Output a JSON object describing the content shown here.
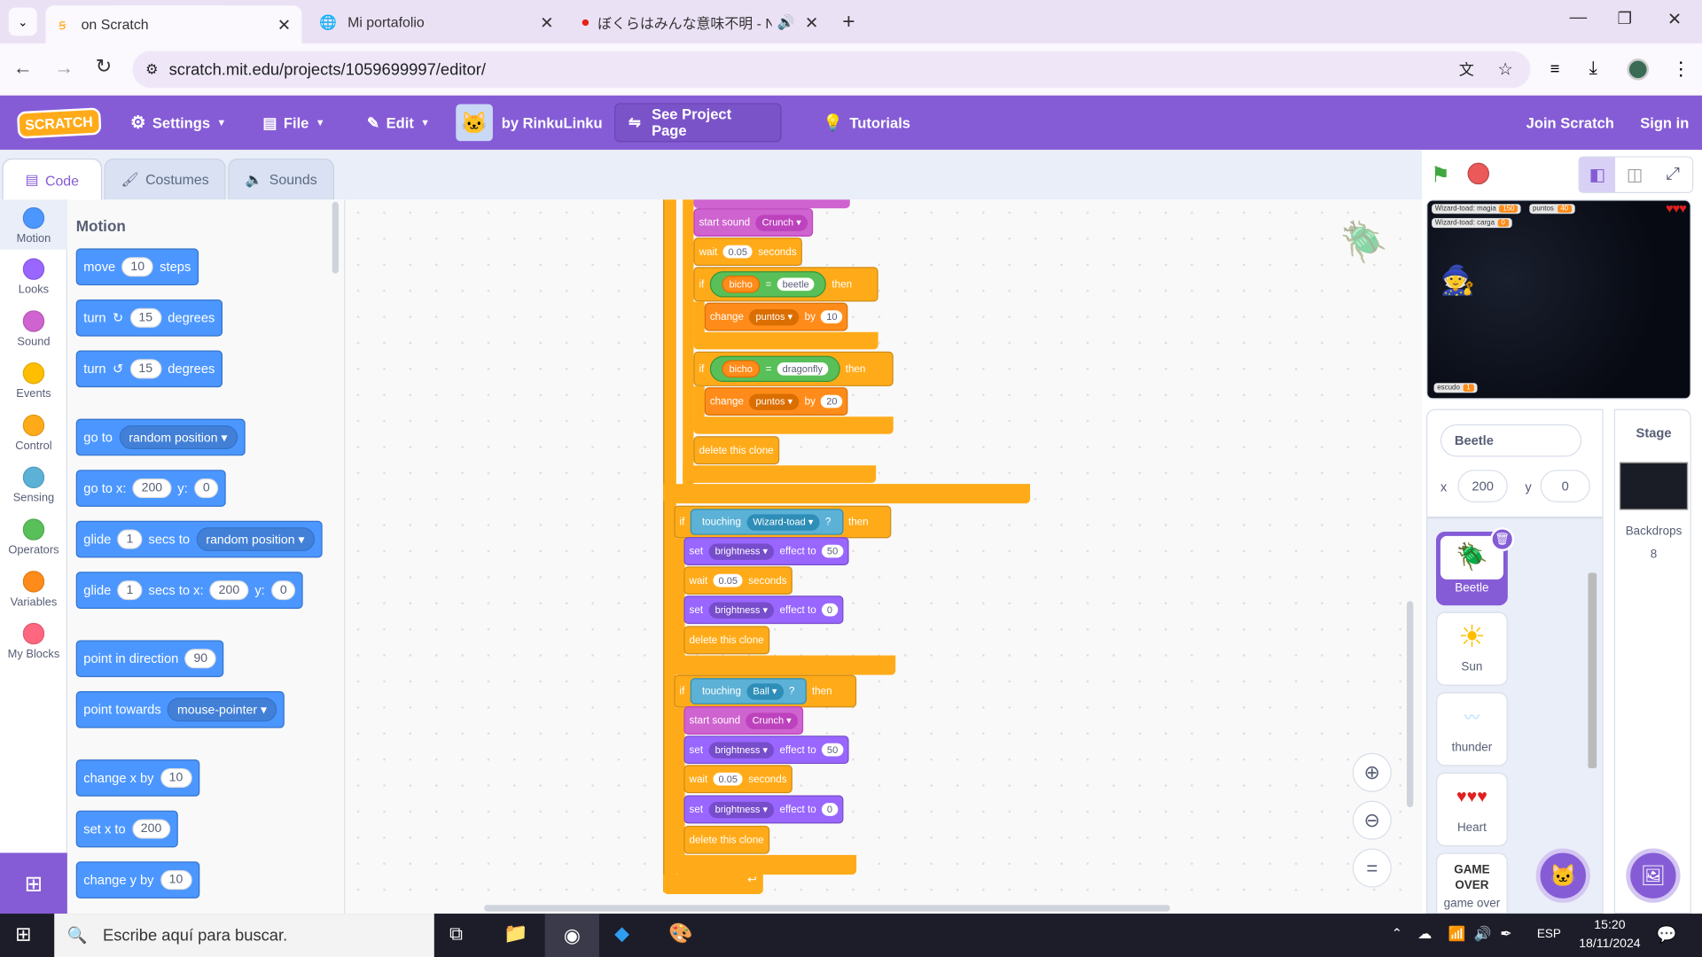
{
  "browser": {
    "tabs": [
      {
        "title": "on Scratch",
        "active": true
      },
      {
        "title": "Mi portafolio",
        "active": false
      },
      {
        "title": "ぼくらはみんな意味不明 - Nol",
        "active": false
      }
    ],
    "url": "scratch.mit.edu/projects/1059699997/editor/"
  },
  "menu": {
    "logo": "SCRATCH",
    "settings": "Settings",
    "file": "File",
    "edit": "Edit",
    "by": "by RinkuLinku",
    "see_project": "See Project Page",
    "tutorials": "Tutorials",
    "join": "Join Scratch",
    "signin": "Sign in"
  },
  "editor_tabs": {
    "code": "Code",
    "costumes": "Costumes",
    "sounds": "Sounds"
  },
  "categories": [
    {
      "label": "Motion",
      "color": "#4c97ff"
    },
    {
      "label": "Looks",
      "color": "#9966ff"
    },
    {
      "label": "Sound",
      "color": "#cf63cf"
    },
    {
      "label": "Events",
      "color": "#ffbf00"
    },
    {
      "label": "Control",
      "color": "#ffab19"
    },
    {
      "label": "Sensing",
      "color": "#5cb1d6"
    },
    {
      "label": "Operators",
      "color": "#59c059"
    },
    {
      "label": "Variables",
      "color": "#ff8c1a"
    },
    {
      "label": "My Blocks",
      "color": "#ff6680"
    }
  ],
  "palette": {
    "heading": "Motion",
    "move": {
      "a": "move",
      "n": "10",
      "b": "steps"
    },
    "turn_cw": {
      "a": "turn",
      "n": "15",
      "b": "degrees"
    },
    "turn_ccw": {
      "a": "turn",
      "n": "15",
      "b": "degrees"
    },
    "goto": {
      "a": "go to",
      "d": "random position"
    },
    "gotoxy": {
      "a": "go to x:",
      "x": "200",
      "b": "y:",
      "y": "0"
    },
    "glide1": {
      "a": "glide",
      "n": "1",
      "b": "secs to",
      "d": "random position"
    },
    "glide2": {
      "a": "glide",
      "n": "1",
      "b": "secs to x:",
      "x": "200",
      "c": "y:",
      "y": "0"
    },
    "point_dir": {
      "a": "point in direction",
      "n": "90"
    },
    "point_towards": {
      "a": "point towards",
      "d": "mouse-pointer"
    },
    "change_x": {
      "a": "change x by",
      "n": "10"
    },
    "set_x": {
      "a": "set x to",
      "n": "200"
    },
    "change_y": {
      "a": "change y by",
      "n": "10"
    }
  },
  "script": {
    "start_sound": "start sound",
    "crunch": "Crunch",
    "wait": "wait",
    "seconds": "seconds",
    "w005": "0.05",
    "if": "if",
    "then": "then",
    "bicho": "bicho",
    "eq": "=",
    "beetle": "beetle",
    "dragonfly": "dragonfly",
    "change": "change",
    "puntos": "puntos",
    "by": "by",
    "n10": "10",
    "n20": "20",
    "delete_clone": "delete this clone",
    "touching": "touching",
    "wizard": "Wizard-toad",
    "ball": "Ball",
    "q": "?",
    "set": "set",
    "brightness": "brightness",
    "effect_to": "effect to",
    "n50": "50",
    "n0": "0"
  },
  "stage": {
    "mon1": "Wizard-toad: magia",
    "mon1v": "150",
    "mon2": "puntos",
    "mon2v": "40",
    "mon3": "Wizard-toad: carga",
    "mon3v": "0",
    "mon4": "escudo",
    "mon4v": "1",
    "hearts": "♥♥♥"
  },
  "sprite_info": {
    "name": "Beetle",
    "x_label": "x",
    "x": "200",
    "y_label": "y",
    "y": "0"
  },
  "sprites": [
    {
      "name": "Beetle"
    },
    {
      "name": "Sun"
    },
    {
      "name": "thunder"
    },
    {
      "name": "Heart"
    },
    {
      "name": "game over"
    }
  ],
  "stage_pane": {
    "title": "Stage",
    "backdrops": "Backdrops",
    "count": "8"
  },
  "taskbar": {
    "search": "Escribe aquí para buscar.",
    "lang": "ESP",
    "time": "15:20",
    "date": "18/11/2024"
  }
}
